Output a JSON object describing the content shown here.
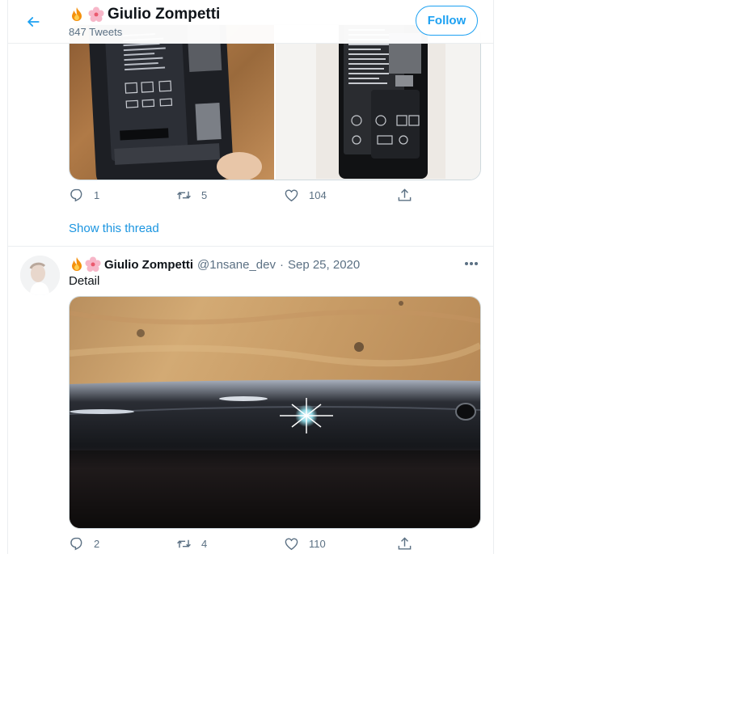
{
  "header": {
    "back_icon": "arrow-left-icon",
    "name": "Giulio Zompetti",
    "name_emojis": [
      "fire-emoji",
      "cherry-blossom-emoji"
    ],
    "tweet_count": "847 Tweets",
    "follow_label": "Follow"
  },
  "tweet1": {
    "reply_count": "1",
    "retweet_count": "5",
    "like_count": "104",
    "share_icon": "share-icon",
    "show_thread": "Show this thread"
  },
  "tweet2": {
    "name": "Giulio Zompetti",
    "handle": "@1nsane_dev",
    "separator": "·",
    "date": "Sep 25, 2020",
    "text": "Detail",
    "reply_count": "2",
    "retweet_count": "4",
    "like_count": "110",
    "more_icon": "more-options-icon"
  },
  "colors": {
    "accent": "#1da1f2",
    "link": "#1b95e0",
    "secondary_text": "#5b7083",
    "border": "#ebeef0"
  }
}
